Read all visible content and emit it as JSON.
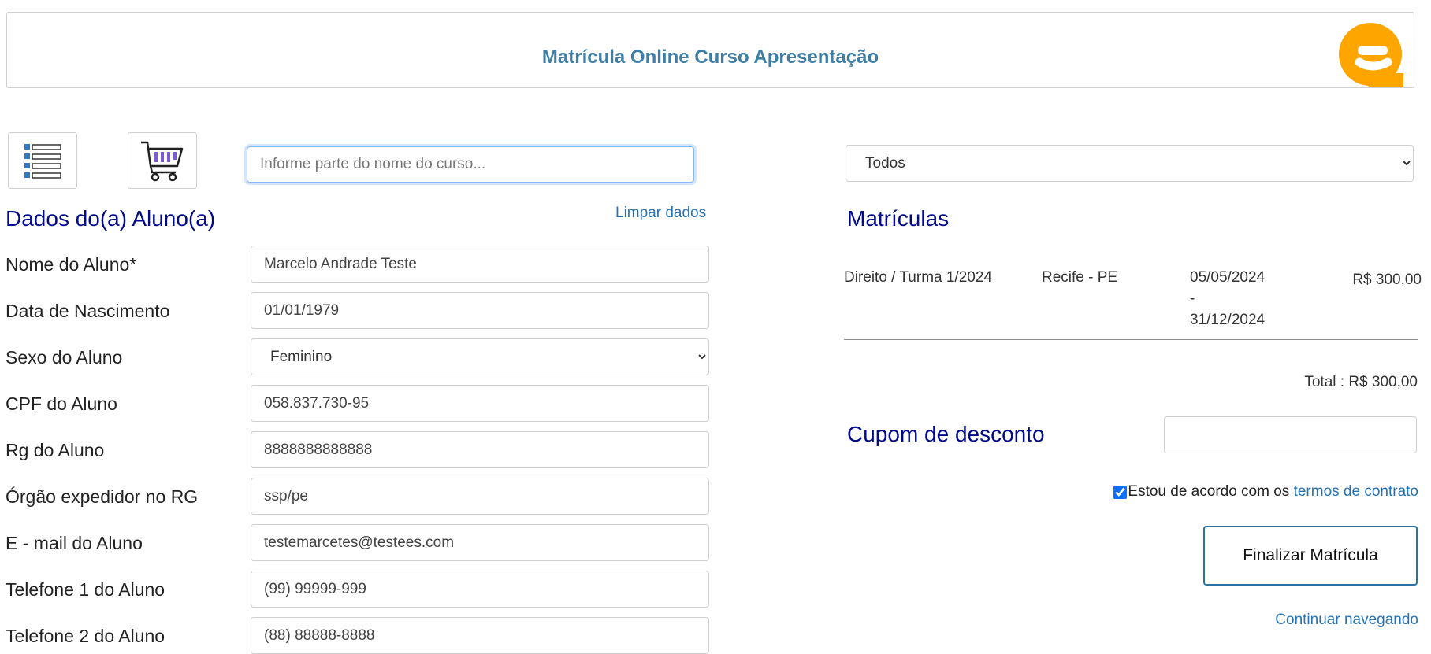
{
  "header": {
    "title": "Matrícula Online Curso Apresentação",
    "logo_icon": "e-logo-icon",
    "logo_color": "#FFA500"
  },
  "toolbar": {
    "list_icon": "list-icon",
    "cart_icon": "shopping-cart-icon",
    "search": {
      "placeholder": "Informe parte do nome do curso...",
      "value": ""
    }
  },
  "filter": {
    "selected": "Todos"
  },
  "student": {
    "title": "Dados do(a) Aluno(a)",
    "clear_label": "Limpar dados",
    "fields": [
      {
        "label": "Nome do Aluno*",
        "value": "Marcelo Andrade Teste"
      },
      {
        "label": "Data de Nascimento",
        "value": "01/01/1979"
      },
      {
        "label": "Sexo do Aluno",
        "value": "Feminino"
      },
      {
        "label": "CPF do Aluno",
        "value": "058.837.730-95"
      },
      {
        "label": "Rg do Aluno",
        "value": "8888888888888"
      },
      {
        "label": "Órgão expedidor no RG",
        "value": "ssp/pe"
      },
      {
        "label": "E - mail do Aluno",
        "value": "testemarcetes@testees.com"
      },
      {
        "label": "Telefone 1 do Aluno",
        "value": "(99) 99999-999"
      },
      {
        "label": "Telefone 2 do Aluno",
        "value": "(88) 88888-8888"
      }
    ]
  },
  "enrollments": {
    "title": "Matrículas",
    "items": [
      {
        "course": "Direito / Turma 1/2024",
        "location": "Recife - PE",
        "date_start": "05/05/2024",
        "date_sep": "-",
        "date_end": "31/12/2024",
        "price": "R$ 300,00"
      }
    ],
    "total": "Total : R$ 300,00"
  },
  "coupon": {
    "title": "Cupom de desconto",
    "value": ""
  },
  "terms": {
    "text": "Estou de acordo com os ",
    "link": "termos de contrato",
    "checked": true
  },
  "actions": {
    "finalize": "Finalizar Matrícula",
    "continue": "Continuar navegando"
  },
  "colors": {
    "accent": "#2573b4",
    "section_title": "#000a8a",
    "header_title": "#3f7fa6"
  }
}
